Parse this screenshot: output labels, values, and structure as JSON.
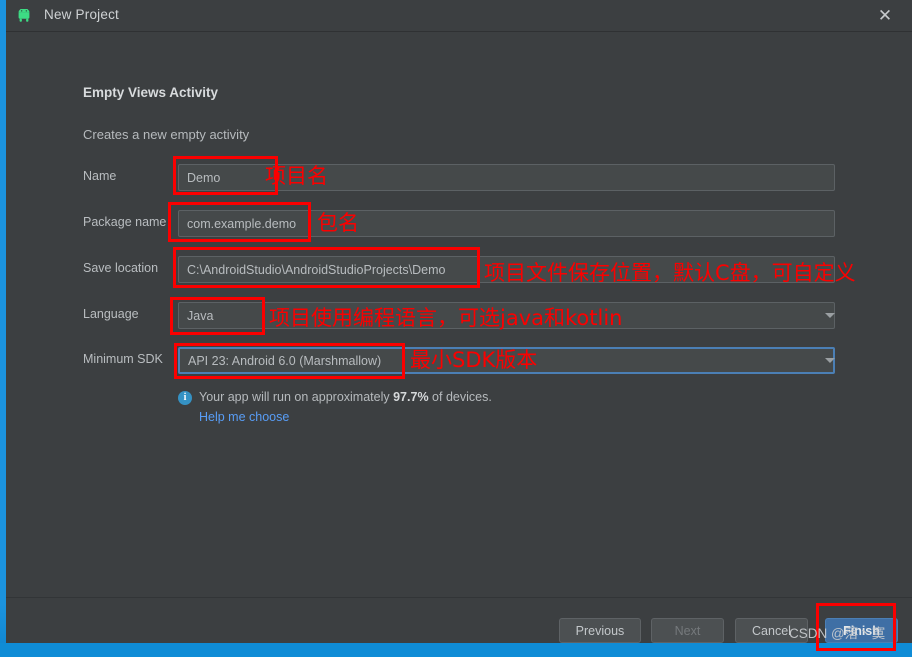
{
  "window": {
    "title": "New Project",
    "icon": "android-robot-icon",
    "close_label": "✕"
  },
  "template": {
    "name": "Empty Views Activity",
    "description": "Creates a new empty activity"
  },
  "fields": [
    {
      "key": "name",
      "label": "Name",
      "value": "Demo",
      "type": "text",
      "focused": false
    },
    {
      "key": "package_name",
      "label": "Package name",
      "value": "com.example.demo",
      "type": "text",
      "focused": false
    },
    {
      "key": "save_location",
      "label": "Save location",
      "value": "C:\\AndroidStudio\\AndroidStudioProjects\\Demo",
      "type": "text",
      "focused": false
    },
    {
      "key": "language",
      "label": "Language",
      "value": "Java",
      "type": "combo",
      "focused": false
    },
    {
      "key": "minimum_sdk",
      "label": "Minimum SDK",
      "value": "API 23: Android 6.0 (Marshmallow)",
      "type": "combo",
      "focused": true
    }
  ],
  "info": {
    "icon": "info-icon",
    "prefix": "Your app will run on approximately",
    "percent": "97.7%",
    "suffix": "of devices.",
    "help_link": "Help me choose"
  },
  "footer": {
    "previous": "Previous",
    "next": "Next",
    "cancel": "Cancel",
    "finish": "Finish"
  },
  "annotations": [
    {
      "key": "name",
      "text": "项目名"
    },
    {
      "key": "package",
      "text": "包名"
    },
    {
      "key": "save_location",
      "text": "项目文件保存位置，默认C盘，可自定义"
    },
    {
      "key": "language",
      "text": "项目使用编程语言，可选java和kotlin"
    },
    {
      "key": "minimum_sdk",
      "text": "最小SDK版本"
    }
  ],
  "watermark": "CSDN @落丶寞",
  "colors": {
    "dialog_bg": "#3c3f41",
    "field_bg": "#45494a",
    "accent_blue": "#4b7fb5",
    "annotation_red": "#fb0000",
    "link_blue": "#589df6",
    "desktop_blue": "#1b93de",
    "android_green": "#3ddc84"
  }
}
